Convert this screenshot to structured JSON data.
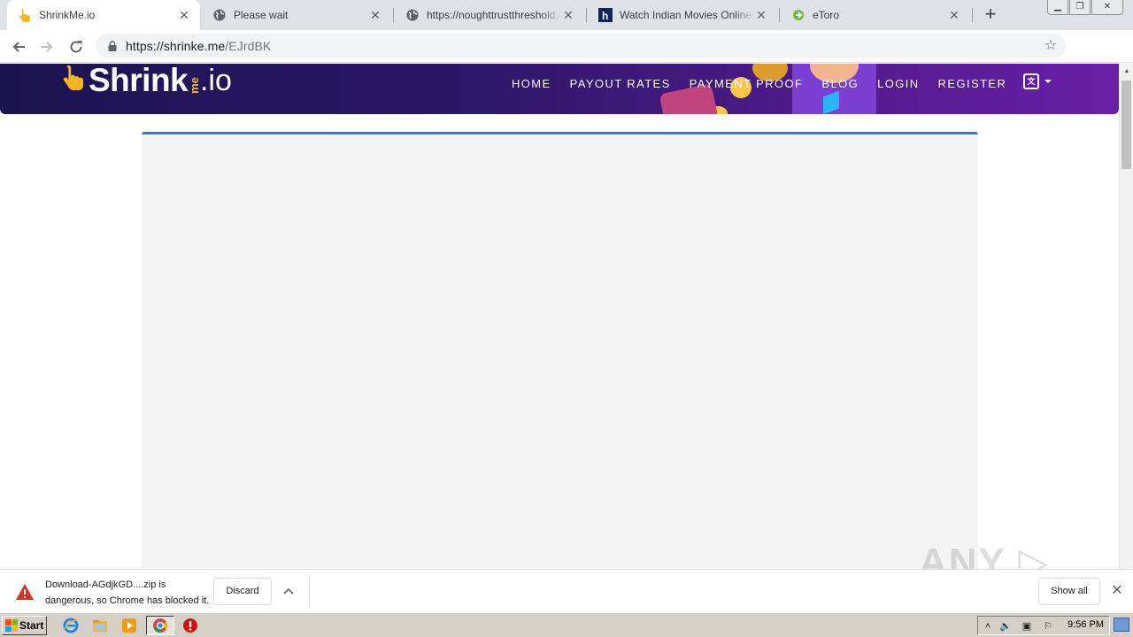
{
  "browser": {
    "tabs": [
      {
        "title": "ShrinkMe.io",
        "active": true,
        "favicon": "hand-pointer-icon"
      },
      {
        "title": "Please wait",
        "active": false,
        "favicon": "globe-icon"
      },
      {
        "title": "https://noughttrustthreshold.co",
        "active": false,
        "favicon": "globe-icon"
      },
      {
        "title": "Watch Indian Movies Online – S",
        "active": false,
        "favicon": "h-logo-icon"
      },
      {
        "title": "eToro",
        "active": false,
        "favicon": "etoro-icon"
      }
    ],
    "close_glyph": "✕",
    "new_tab_glyph": "+",
    "url_host": "https://shrinke.me",
    "url_path": "/EJrdBK"
  },
  "site": {
    "logo_main": "Shrink",
    "logo_me": "me",
    "logo_io": ".io",
    "nav": [
      "HOME",
      "PAYOUT RATES",
      "PAYMENT PROOF",
      "BLOG",
      "LOGIN",
      "REGISTER"
    ],
    "colors": {
      "header_start": "#1c1450",
      "header_end": "#6a1fa8",
      "accent": "#f6b51e",
      "content_border": "#2c7be5"
    }
  },
  "download_bar": {
    "line1": "Download-AGdjkGD....zip is",
    "line2": "dangerous, so Chrome has blocked it.",
    "discard_label": "Discard",
    "show_all_label": "Show all",
    "close_glyph": "✕"
  },
  "watermark": "ANY ▷ RUN",
  "taskbar": {
    "start_label": "Start",
    "clock": "9:56 PM"
  }
}
